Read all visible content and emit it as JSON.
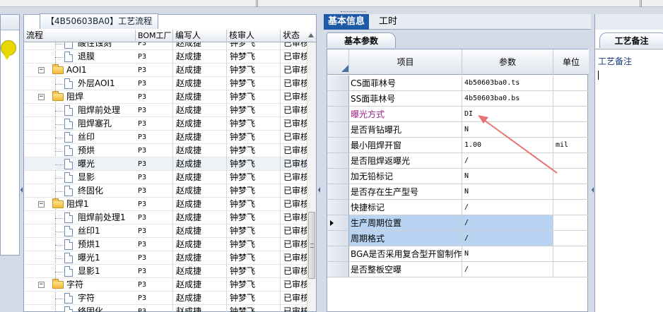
{
  "process_tree": {
    "title": "【4B50603BA0】工艺流程",
    "columns": [
      "流程",
      "BOM工厂",
      "编写人",
      "核审人",
      "状态"
    ],
    "rows": [
      {
        "name": "酸性蚀刻",
        "level": 2,
        "kind": "doc",
        "bom": "P3",
        "writer": "赵成捷",
        "reviewer": "钟梦飞",
        "status": "已审核"
      },
      {
        "name": "退膜",
        "level": 2,
        "kind": "doc",
        "bom": "P3",
        "writer": "赵成捷",
        "reviewer": "钟梦飞",
        "status": "已审核"
      },
      {
        "name": "AOI1",
        "level": 1,
        "kind": "folder",
        "bom": "P3",
        "writer": "赵成捷",
        "reviewer": "钟梦飞",
        "status": "已审核"
      },
      {
        "name": "外层AOI1",
        "level": 2,
        "kind": "doc",
        "bom": "P3",
        "writer": "赵成捷",
        "reviewer": "钟梦飞",
        "status": "已审核"
      },
      {
        "name": "阻焊",
        "level": 1,
        "kind": "folder",
        "bom": "P3",
        "writer": "赵成捷",
        "reviewer": "钟梦飞",
        "status": "已审核"
      },
      {
        "name": "阻焊前处理",
        "level": 2,
        "kind": "doc",
        "bom": "P3",
        "writer": "赵成捷",
        "reviewer": "钟梦飞",
        "status": "已审核"
      },
      {
        "name": "阻焊塞孔",
        "level": 2,
        "kind": "doc",
        "bom": "P3",
        "writer": "赵成捷",
        "reviewer": "钟梦飞",
        "status": "已审核"
      },
      {
        "name": "丝印",
        "level": 2,
        "kind": "doc",
        "bom": "P3",
        "writer": "赵成捷",
        "reviewer": "钟梦飞",
        "status": "已审核"
      },
      {
        "name": "预烘",
        "level": 2,
        "kind": "doc",
        "bom": "P3",
        "writer": "赵成捷",
        "reviewer": "钟梦飞",
        "status": "已审核"
      },
      {
        "name": "曝光",
        "level": 2,
        "kind": "doc",
        "bom": "P3",
        "writer": "赵成捷",
        "reviewer": "钟梦飞",
        "status": "已审核",
        "selected": true
      },
      {
        "name": "显影",
        "level": 2,
        "kind": "doc",
        "bom": "P3",
        "writer": "赵成捷",
        "reviewer": "钟梦飞",
        "status": "已审核"
      },
      {
        "name": "终固化",
        "level": 2,
        "kind": "doc",
        "bom": "P3",
        "writer": "赵成捷",
        "reviewer": "钟梦飞",
        "status": "已审核"
      },
      {
        "name": "阻焊1",
        "level": 1,
        "kind": "folder",
        "bom": "P3",
        "writer": "赵成捷",
        "reviewer": "钟梦飞",
        "status": "已审核"
      },
      {
        "name": "阻焊前处理1",
        "level": 2,
        "kind": "doc",
        "bom": "P3",
        "writer": "赵成捷",
        "reviewer": "钟梦飞",
        "status": "已审核"
      },
      {
        "name": "丝印1",
        "level": 2,
        "kind": "doc",
        "bom": "P3",
        "writer": "赵成捷",
        "reviewer": "钟梦飞",
        "status": "已审核"
      },
      {
        "name": "预烘1",
        "level": 2,
        "kind": "doc",
        "bom": "P3",
        "writer": "赵成捷",
        "reviewer": "钟梦飞",
        "status": "已审核"
      },
      {
        "name": "曝光1",
        "level": 2,
        "kind": "doc",
        "bom": "P3",
        "writer": "赵成捷",
        "reviewer": "钟梦飞",
        "status": "已审核"
      },
      {
        "name": "显影1",
        "level": 2,
        "kind": "doc",
        "bom": "P3",
        "writer": "赵成捷",
        "reviewer": "钟梦飞",
        "status": "已审核"
      },
      {
        "name": "字符",
        "level": 1,
        "kind": "folder",
        "bom": "P3",
        "writer": "赵成捷",
        "reviewer": "钟梦飞",
        "status": "已审核"
      },
      {
        "name": "字符",
        "level": 2,
        "kind": "doc",
        "bom": "P3",
        "writer": "赵成捷",
        "reviewer": "钟梦飞",
        "status": "已审核"
      },
      {
        "name": "终固化",
        "level": 2,
        "kind": "doc",
        "bom": "P3",
        "writer": "赵成捷",
        "reviewer": "钟梦飞",
        "status": "已审核"
      }
    ]
  },
  "info_panel": {
    "tabs": [
      "基本信息",
      "工时"
    ],
    "sub_tab": "基本参数",
    "columns": [
      "项目",
      "参数",
      "单位"
    ],
    "rows": [
      {
        "item": "CS面菲林号",
        "value": "4b50603ba0.ts",
        "unit": ""
      },
      {
        "item": "SS面菲林号",
        "value": "4b50603ba0.bs",
        "unit": ""
      },
      {
        "item": "曝光方式",
        "value": "DI",
        "unit": "",
        "highlight": "magenta"
      },
      {
        "item": "是否背钻曝孔",
        "value": "N",
        "unit": ""
      },
      {
        "item": "最小阻焊开窗",
        "value": "1.00",
        "unit": "mil"
      },
      {
        "item": "是否阻焊返曝光",
        "value": "/",
        "unit": ""
      },
      {
        "item": "加无铅标记",
        "value": "N",
        "unit": ""
      },
      {
        "item": "是否存在生产型号",
        "value": "N",
        "unit": ""
      },
      {
        "item": "快捷标记",
        "value": "/",
        "unit": ""
      },
      {
        "item": "生产周期位置",
        "value": "/",
        "unit": "",
        "selected": true,
        "current": true
      },
      {
        "item": "周期格式",
        "value": "/",
        "unit": "",
        "selected": true
      },
      {
        "item": "BGA是否采用复合型开窗制作",
        "value": "N",
        "unit": ""
      },
      {
        "item": "是否整板空曝",
        "value": "/",
        "unit": ""
      }
    ],
    "annotation_color": "#e87272"
  },
  "notes_panel": {
    "title": "工艺备注",
    "label": "工艺备注"
  },
  "colors": {
    "accent": "#1f5aa6",
    "selection": "#b8d4f2",
    "magenta_text": "#a0208a"
  }
}
